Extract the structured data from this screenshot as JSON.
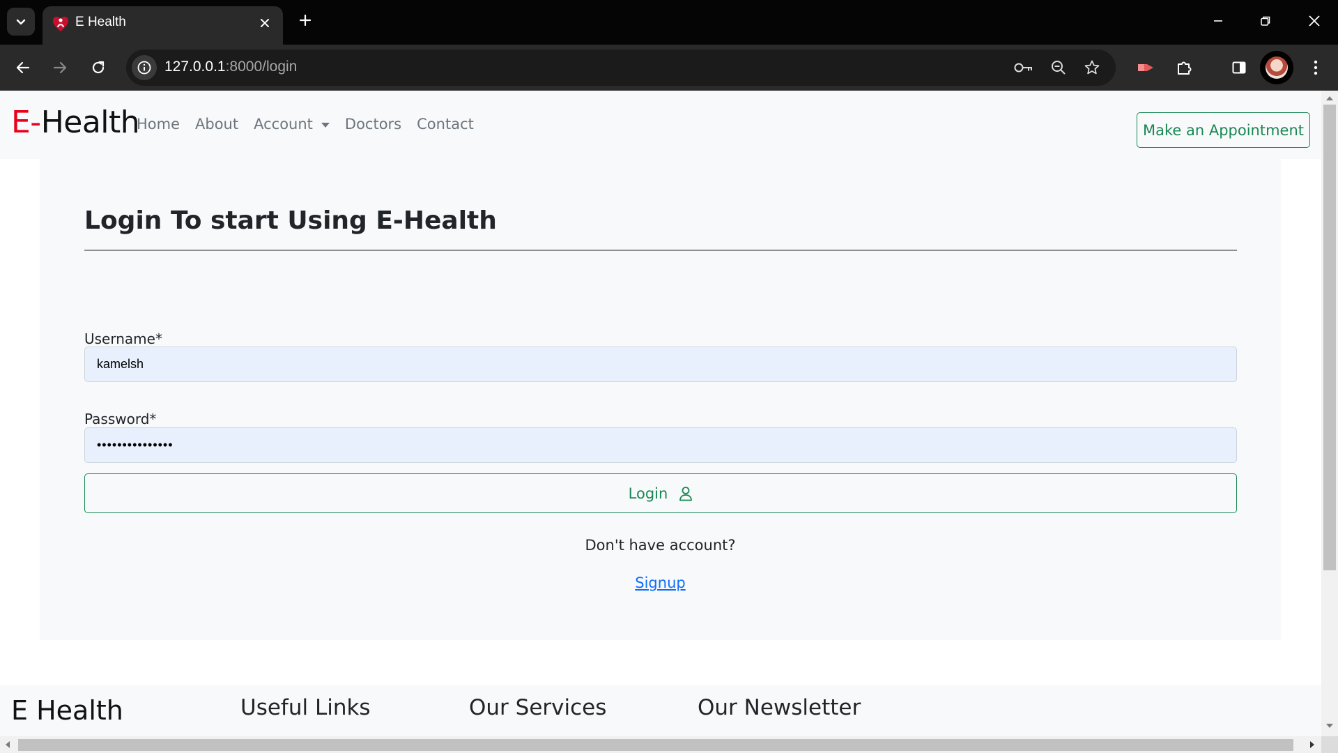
{
  "browser": {
    "tab_title": "E Health",
    "url_host": "127.0.0.1",
    "url_path": ":8000/login",
    "icons": [
      "tab-search-icon",
      "favicon-icon",
      "close-icon",
      "plus-icon",
      "minimize-icon",
      "restore-icon",
      "close-window-icon",
      "back-icon",
      "forward-icon",
      "reload-icon",
      "info-icon",
      "key-icon",
      "zoom-icon",
      "star-icon",
      "extension-red-icon",
      "puzzle-icon",
      "sidepanel-icon",
      "profile-avatar",
      "more-icon"
    ]
  },
  "navbar": {
    "brand_prefix": "E-",
    "brand_rest": "Health",
    "links": [
      "Home",
      "About",
      "Account",
      "Doctors",
      "Contact"
    ],
    "appointment_button": "Make an Appointment"
  },
  "login": {
    "title": "Login To start Using E-Health",
    "username_label": "Username*",
    "username_value": "kamelsh",
    "password_label": "Password*",
    "password_value": "•••••••••••••••",
    "login_button": "Login",
    "no_account_text": "Don't have account?",
    "signup_link": "Signup"
  },
  "footer": {
    "brand": "E Health",
    "useful_links": "Useful Links",
    "our_services": "Our Services",
    "our_newsletter": "Our Newsletter"
  },
  "colors": {
    "brand_accent": "#e8001c",
    "success": "#198754",
    "link": "#0d6efd",
    "autofill_bg": "#e8f0fe"
  }
}
